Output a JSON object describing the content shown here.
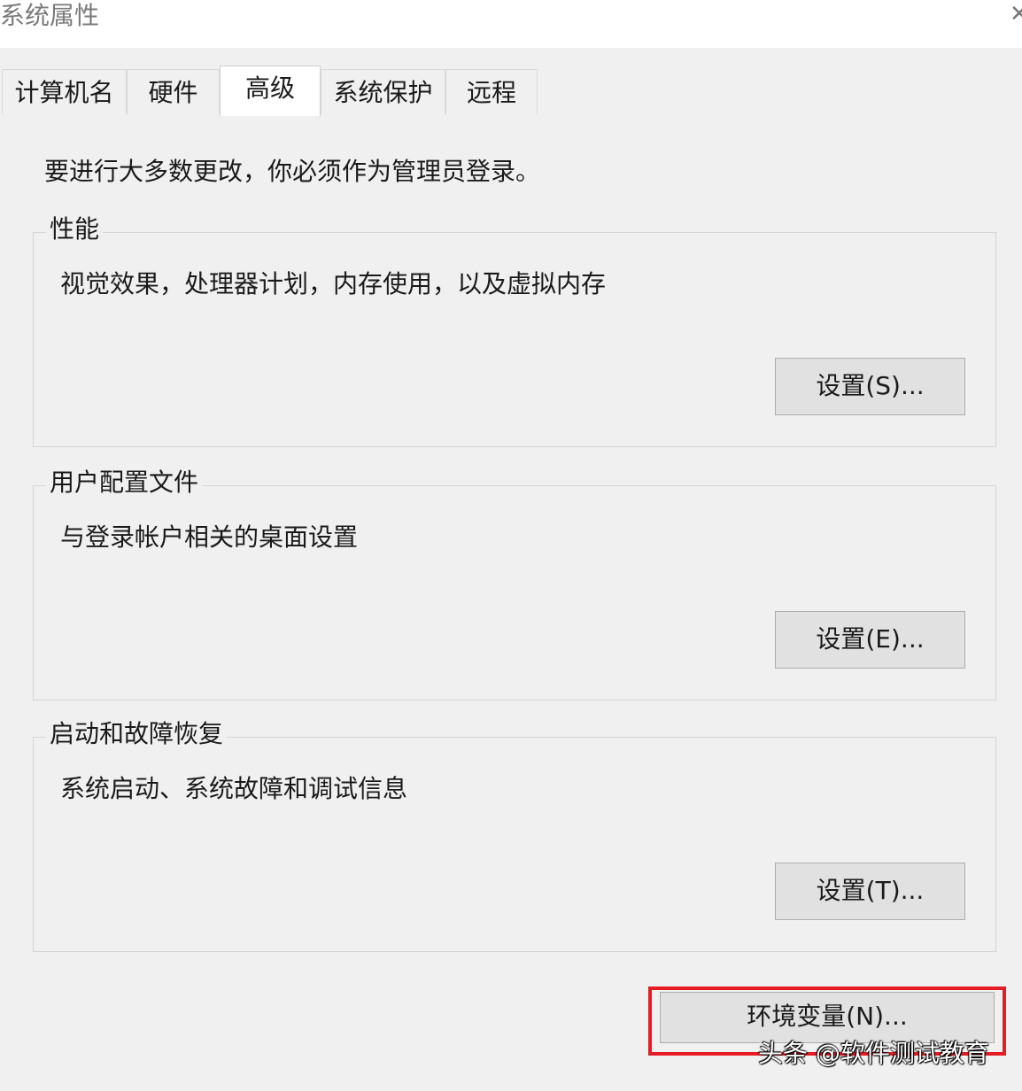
{
  "window": {
    "title": "系统属性",
    "close_glyph": "✕"
  },
  "tabs": [
    {
      "label": "计算机名",
      "active": false
    },
    {
      "label": "硬件",
      "active": false
    },
    {
      "label": "高级",
      "active": true
    },
    {
      "label": "系统保护",
      "active": false
    },
    {
      "label": "远程",
      "active": false
    }
  ],
  "advanced": {
    "notice": "要进行大多数更改，你必须作为管理员登录。",
    "performance": {
      "legend": "性能",
      "description": "视觉效果，处理器计划，内存使用，以及虚拟内存",
      "button": "设置(S)..."
    },
    "user_profiles": {
      "legend": "用户配置文件",
      "description": "与登录帐户相关的桌面设置",
      "button": "设置(E)..."
    },
    "startup_recovery": {
      "legend": "启动和故障恢复",
      "description": "系统启动、系统故障和调试信息",
      "button": "设置(T)..."
    },
    "env_button": "环境变量(N)..."
  },
  "highlight_color": "#e51c23",
  "watermark": "头条 @软件测试教育"
}
